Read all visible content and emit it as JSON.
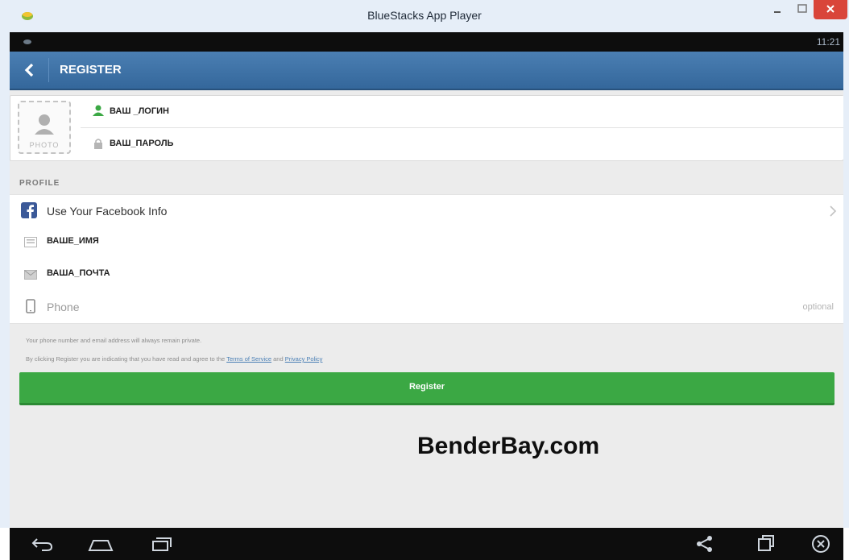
{
  "window": {
    "title": "BlueStacks App Player"
  },
  "status_bar": {
    "time": "11:21"
  },
  "action_bar": {
    "title": "REGISTER",
    "back_icon": "chevron-left-icon"
  },
  "account": {
    "photo_label": "PHOTO",
    "login_value": "ВАШ _ЛОГИН",
    "password_value": "ВАШ_ПАРОЛЬ"
  },
  "profile": {
    "section_label": "PROFILE",
    "facebook_label": "Use Your Facebook Info",
    "name_value": "ВАШЕ_ИМЯ",
    "email_value": "ВАША_ПОЧТА",
    "phone_placeholder": "Phone",
    "phone_optional": "optional"
  },
  "legal": {
    "privacy_note": "Your phone number and email address will always remain private.",
    "terms_prefix": "By clicking Register you are indicating that you have read and agree to the",
    "terms_link": "Terms of Service",
    "and_word": "and",
    "privacy_link": "Privacy Policy"
  },
  "register_button": {
    "label": "Register"
  },
  "watermark": {
    "text": "BenderBay.com"
  },
  "colors": {
    "action_bar": "#3f73a8",
    "register": "#3ba844",
    "login_icon": "#3ba844",
    "facebook": "#3b5998",
    "close_button": "#d9453a"
  }
}
